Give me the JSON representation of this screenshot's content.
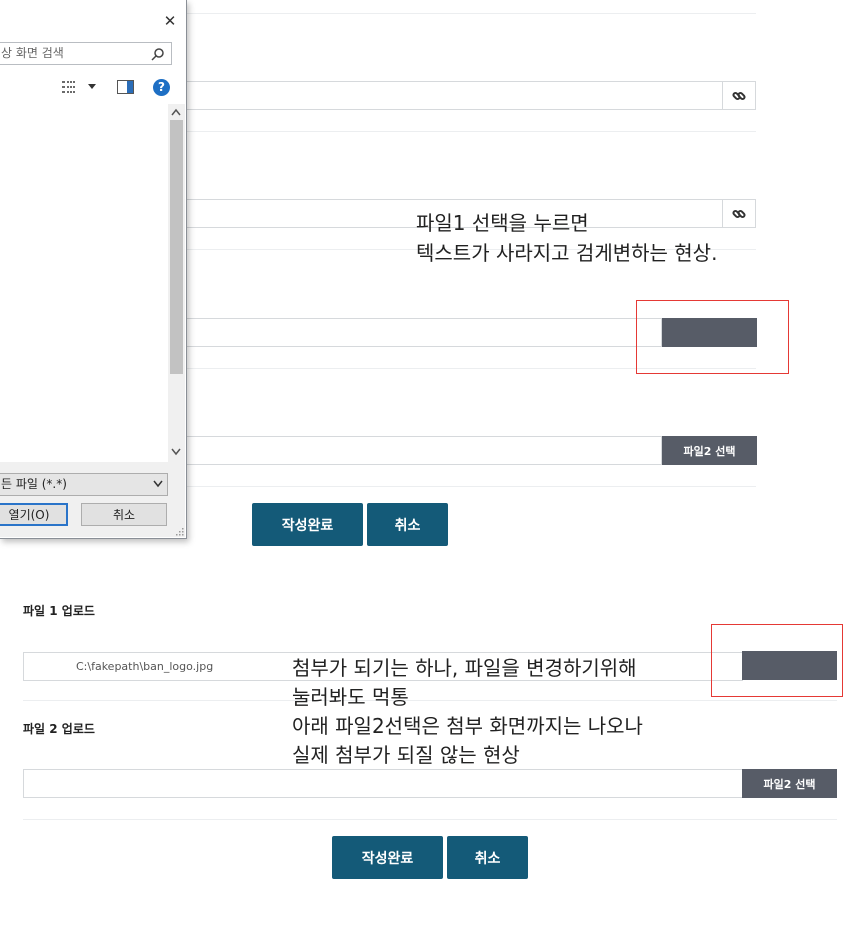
{
  "dialog": {
    "close_glyph": "✕",
    "search_placeholder": "상 화면 검색",
    "file_type": "든 파일 (*.*)",
    "open_label": "열기(O)",
    "cancel_label": "취소",
    "help_glyph": "?"
  },
  "top_form": {
    "file2_button": "파일2 선택",
    "submit_label": "작성완료",
    "cancel_label": "취소"
  },
  "bottom_form": {
    "file1_section": "파일 1 업로드",
    "file1_value": "C:\\fakepath\\ban_logo.jpg",
    "file2_section": "파일 2 업로드",
    "file2_button": "파일2 선택",
    "submit_label": "작성완료",
    "cancel_label": "취소"
  },
  "annotations": {
    "note1_line1": "파일1 선택을 누르면",
    "note1_line2": "텍스트가 사라지고 검게변하는 현상.",
    "note2_line1": "첨부가 되기는 하나, 파일을 변경하기위해",
    "note2_line2": "눌러봐도 먹통",
    "note2_line3": "아래 파일2선택은 첨부 화면까지는 나오나",
    "note2_line4": "실제 첨부가 되질 않는 현상"
  },
  "colors": {
    "primary": "#145a78",
    "file_button": "#575c67",
    "annotation_border": "#e53935"
  }
}
